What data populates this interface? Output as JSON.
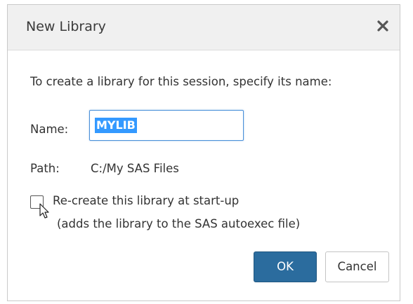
{
  "dialog": {
    "title": "New Library",
    "close_icon": "close-icon",
    "prompt": "To create a library for this session, specify its name:",
    "name_label": "Name:",
    "name_value": "MYLIB",
    "path_label": "Path:",
    "path_value": "C:/My SAS Files",
    "recreate_label": "Re-create this library at start-up",
    "recreate_note": "(adds the library to the SAS autoexec file)",
    "recreate_checked": false,
    "ok_label": "OK",
    "cancel_label": "Cancel"
  },
  "colors": {
    "titlebar_bg": "#f0f0f0",
    "primary_button": "#2b6c9e",
    "selection": "#3399ff",
    "input_focus_border": "#4a90d9"
  }
}
